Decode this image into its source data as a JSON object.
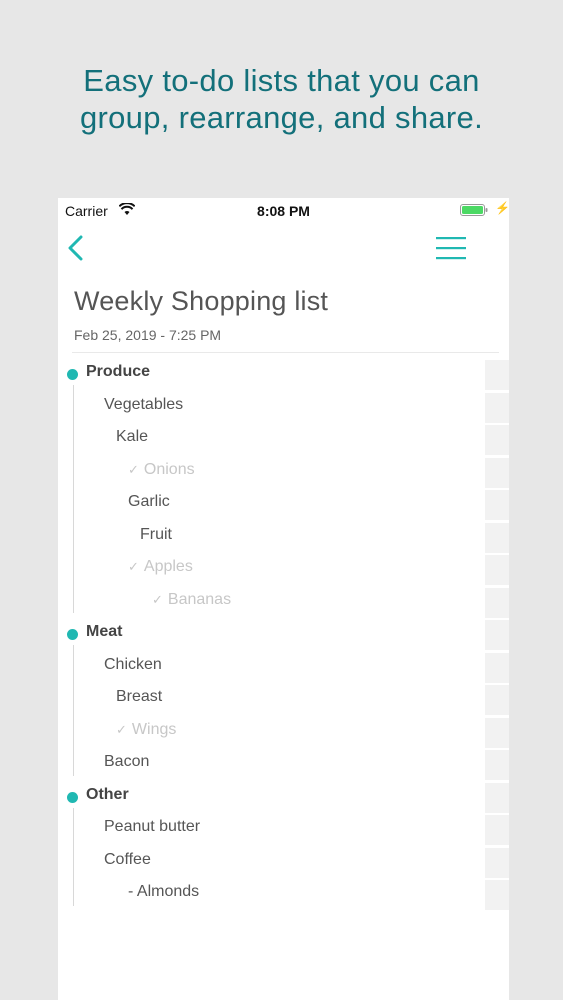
{
  "headline": {
    "line1": "Easy to-do lists that you can",
    "line2": "group, rearrange, and share."
  },
  "status_bar": {
    "carrier": "Carrier",
    "time": "8:08 PM",
    "battery_color": "#4cd964"
  },
  "accent_color": "#20b8b2",
  "nav": {
    "back_icon": "chevron-left-icon",
    "menu_icon": "hamburger-menu-icon"
  },
  "list": {
    "title": "Weekly Shopping list",
    "date": "Feb 25, 2019 - 7:25 PM",
    "items": [
      {
        "label": "Produce",
        "level": 0,
        "type": "group",
        "done": false
      },
      {
        "label": "Vegetables",
        "level": 1,
        "type": "item",
        "done": false
      },
      {
        "label": "Kale",
        "level": 2,
        "type": "item",
        "done": false
      },
      {
        "label": "Onions",
        "level": 3,
        "type": "item",
        "done": true
      },
      {
        "label": "Garlic",
        "level": 3,
        "type": "item",
        "done": false
      },
      {
        "label": "Fruit",
        "level": 4,
        "type": "item",
        "done": false
      },
      {
        "label": "Apples",
        "level": 3,
        "type": "item",
        "done": true
      },
      {
        "label": "Bananas",
        "level": 5,
        "type": "item",
        "done": true
      },
      {
        "label": "Meat",
        "level": 0,
        "type": "group",
        "done": false
      },
      {
        "label": "Chicken",
        "level": 1,
        "type": "item",
        "done": false
      },
      {
        "label": "Breast",
        "level": 2,
        "type": "item",
        "done": false
      },
      {
        "label": "Wings",
        "level": 2,
        "type": "item",
        "done": true
      },
      {
        "label": "Bacon",
        "level": 1,
        "type": "item",
        "done": false
      },
      {
        "label": "Other",
        "level": 0,
        "type": "group",
        "done": false
      },
      {
        "label": "Peanut butter",
        "level": 1,
        "type": "item",
        "done": false
      },
      {
        "label": "Coffee",
        "level": 1,
        "type": "item",
        "done": false
      },
      {
        "label": "- Almonds",
        "level": 3,
        "type": "item",
        "done": false
      }
    ]
  }
}
